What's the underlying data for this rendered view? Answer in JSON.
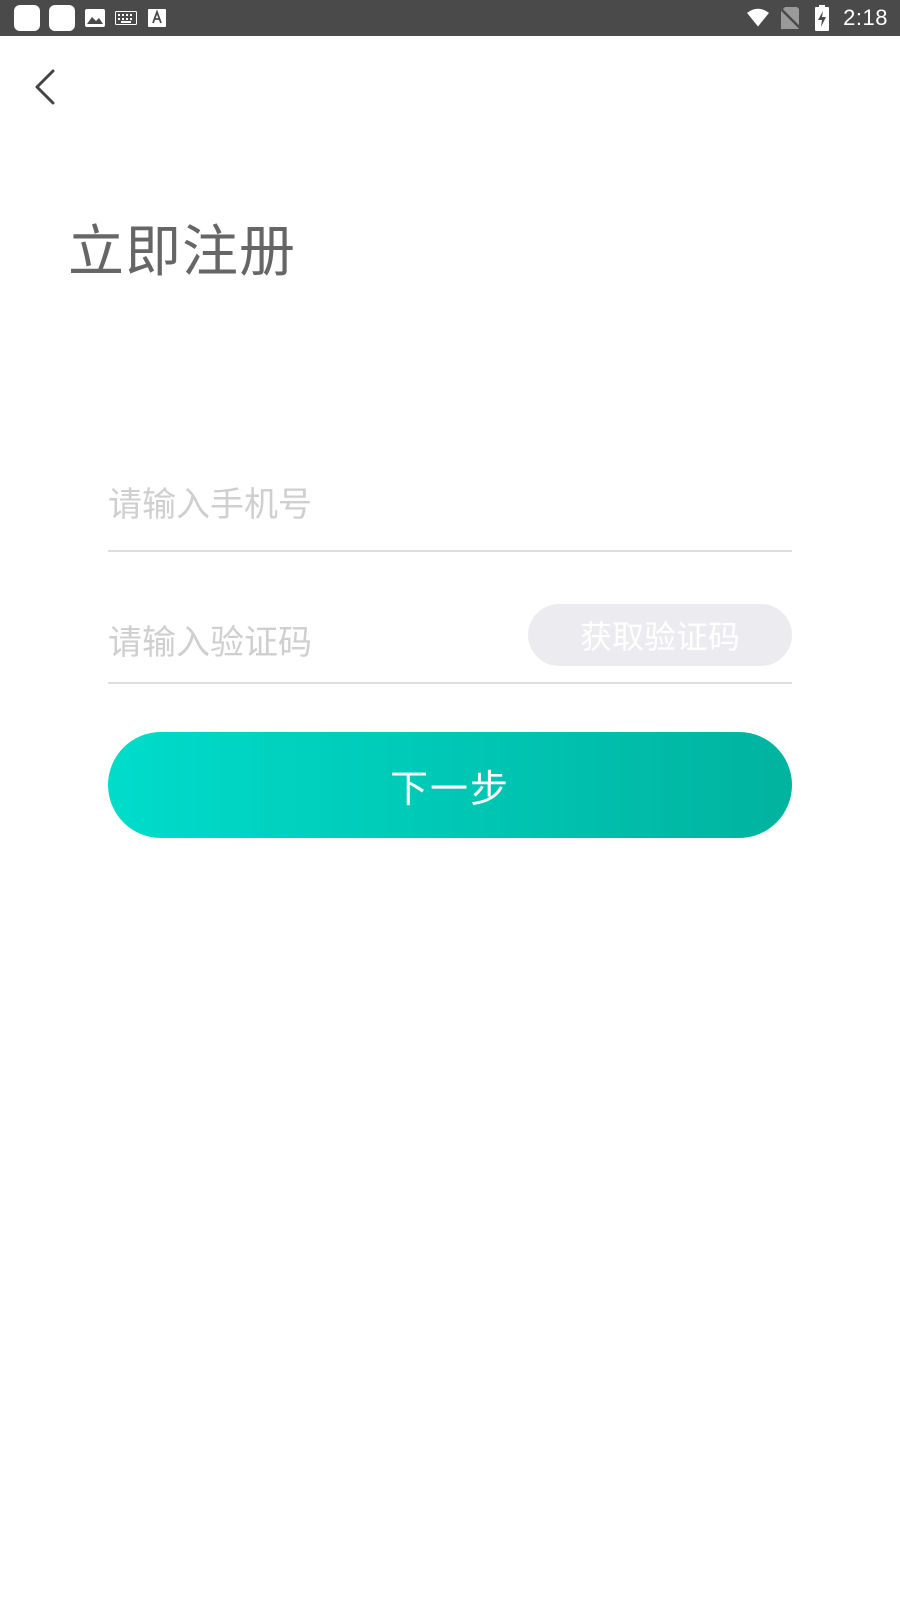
{
  "status_bar": {
    "left_icons": [
      "app-icon",
      "app-icon",
      "image-icon",
      "keyboard-icon",
      "text-icon"
    ],
    "right_icons": [
      "wifi-icon",
      "no-sim-icon",
      "battery-charging-icon"
    ],
    "time": "2:18"
  },
  "header": {
    "back_icon": "chevron-left-icon"
  },
  "page": {
    "title": "立即注册"
  },
  "form": {
    "phone_placeholder": "请输入手机号",
    "phone_value": "",
    "code_placeholder": "请输入验证码",
    "code_value": "",
    "get_code_label": "获取验证码",
    "next_label": "下一步"
  },
  "colors": {
    "status_bar_bg": "#4a4a4a",
    "title_text": "#666666",
    "placeholder_text": "#cfcfcf",
    "divider": "#dedede",
    "get_code_bg": "#ececf0",
    "button_gradient_start": "#00dccb",
    "button_gradient_end": "#00b39f"
  }
}
